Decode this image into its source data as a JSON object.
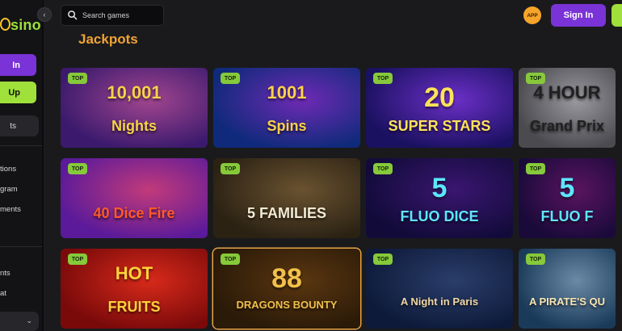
{
  "brand": {
    "logo_text": "sino"
  },
  "sidebar": {
    "login_label": "In",
    "signup_label": "Up",
    "pill_label": "ts",
    "links": [
      "tions",
      "gram",
      "ments",
      "nts",
      "at"
    ],
    "collapse_glyph": "‹"
  },
  "topbar": {
    "search_placeholder": "Search games",
    "app_badge": "APP",
    "signin_label": "Sign In"
  },
  "main": {
    "section_title": "Jackpots",
    "tag_label": "TOP",
    "tiles": [
      {
        "name": "10,001 Nights",
        "line1": "10,001",
        "line2": "Nights",
        "bg": "#3b1a6d",
        "bg2": "#a2458f",
        "fg": "#f6d34a"
      },
      {
        "name": "1001 Spins",
        "line1": "1001",
        "line2": "Spins",
        "bg": "#0f2a7a",
        "bg2": "#6f2ab5",
        "fg": "#ffd24a"
      },
      {
        "name": "20 Super Stars",
        "line1": "20",
        "line2": "SUPER STARS",
        "bg": "#1a1160",
        "bg2": "#6c2fc8",
        "fg": "#ffe25a"
      },
      {
        "name": "4 Hour Grand Prix",
        "line1": "4 HOUR",
        "line2": "Grand Prix",
        "bg": "#4a4a4f",
        "bg2": "#9a9aa0",
        "fg": "#202020"
      },
      {
        "name": "40 Dice Fire",
        "line1": "",
        "line2": "40 Dice Fire",
        "bg": "#5a1a9a",
        "bg2": "#c23a7a",
        "fg": "#ff5a2a"
      },
      {
        "name": "5 Families",
        "line1": "",
        "line2": "5 FAMILIES",
        "bg": "#2b2214",
        "bg2": "#6a5230",
        "fg": "#f2ead2"
      },
      {
        "name": "5 Fluo Dice",
        "line1": "5",
        "line2": "FLUO DICE",
        "bg": "#120b3a",
        "bg2": "#3a1670",
        "fg": "#5de6ff"
      },
      {
        "name": "5 Fluo",
        "line1": "5",
        "line2": "FLUO F",
        "bg": "#1a0a3a",
        "bg2": "#5a1460",
        "fg": "#5de6ff"
      },
      {
        "name": "Hot Fruits",
        "line1": "HOT",
        "line2": "FRUITS",
        "bg": "#7a0a0a",
        "bg2": "#d82a1a",
        "fg": "#ffd23a"
      },
      {
        "name": "Dragons Bounty",
        "line1": "88",
        "line2": "DRAGONS BOUNTY",
        "bg": "#2a1a08",
        "bg2": "#5a3610",
        "fg": "#f2c04a"
      },
      {
        "name": "A Night in Paris",
        "line1": "",
        "line2": "A Night in Paris",
        "bg": "#0e1a3a",
        "bg2": "#2a3e6a",
        "fg": "#f0d6a2"
      },
      {
        "name": "A Pirate's Quest",
        "line1": "",
        "line2": "A PIRATE'S QU",
        "bg": "#1a3a5a",
        "bg2": "#6a8aa6",
        "fg": "#f7e6b2"
      }
    ]
  }
}
